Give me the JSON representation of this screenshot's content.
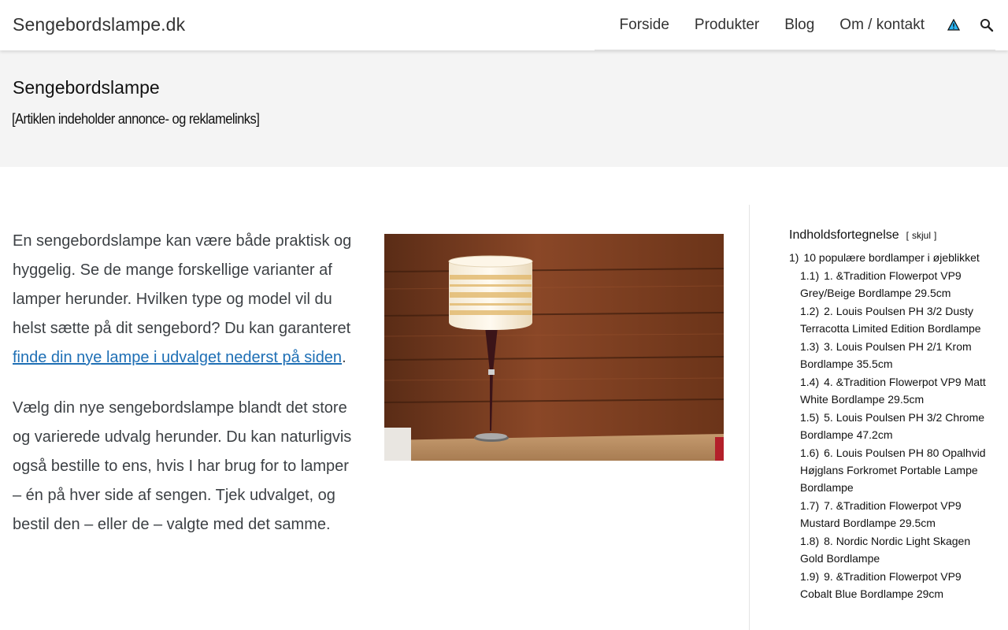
{
  "header": {
    "site_title": "Sengebordslampe.dk",
    "nav": [
      {
        "label": "Forside"
      },
      {
        "label": "Produkter"
      },
      {
        "label": "Blog"
      },
      {
        "label": "Om / kontakt"
      }
    ],
    "icons": [
      "warning-icon",
      "search-icon"
    ]
  },
  "title_band": {
    "title": "Sengebordslampe",
    "disclaimer": "[Artiklen indeholder annonce- og reklamelinks]"
  },
  "intro": {
    "p1_text": "En sengebordslampe kan være både praktisk og hyggelig. Se de mange forskellige varianter af lamper herunder. Hvilken type og model vil du helst sætte på dit sengebord? Du kan garanteret ",
    "p1_link": "finde din nye lampe i udvalget nederst på siden",
    "p1_end": ".",
    "p2": "Vælg din nye sengebordslampe blandt det store og varierede udvalg herunder. Du kan naturligvis også bestille to ens, hvis I har brug for to lamper – én på hver side af sengen. Tjek udvalget, og bestil den – eller de – valgte med det samme."
  },
  "toc": {
    "title": "Indholdsfortegnelse",
    "toggle_open": "[",
    "toggle_label": "skjul",
    "toggle_close": "]",
    "items": [
      {
        "num": "1)",
        "text": "10 populære bordlamper i øjeblikket"
      },
      {
        "num": "1.1)",
        "text": "1. &Tradition Flowerpot VP9 Grey/Beige Bordlampe 29.5cm"
      },
      {
        "num": "1.2)",
        "text": "2. Louis Poulsen PH 3/2 Dusty Terracotta Limited Edition Bordlampe"
      },
      {
        "num": "1.3)",
        "text": "3. Louis Poulsen PH 2/1 Krom Bordlampe 35.5cm"
      },
      {
        "num": "1.4)",
        "text": "4. &Tradition Flowerpot VP9 Matt White Bordlampe 29.5cm"
      },
      {
        "num": "1.5)",
        "text": "5. Louis Poulsen PH 3/2 Chrome Bordlampe 47.2cm"
      },
      {
        "num": "1.6)",
        "text": "6. Louis Poulsen PH 80 Opalhvid Højglans Forkromet Portable Lampe Bordlampe"
      },
      {
        "num": "1.7)",
        "text": "7. &Tradition Flowerpot VP9 Mustard Bordlampe 29.5cm"
      },
      {
        "num": "1.8)",
        "text": "8. Nordic Nordic Light Skagen Gold Bordlampe"
      },
      {
        "num": "1.9)",
        "text": "9. &Tradition Flowerpot VP9 Cobalt Blue Bordlampe 29cm"
      }
    ]
  },
  "colors": {
    "link": "#1e6fb5",
    "band": "#f4f4f4",
    "body_text": "#3d4145"
  }
}
